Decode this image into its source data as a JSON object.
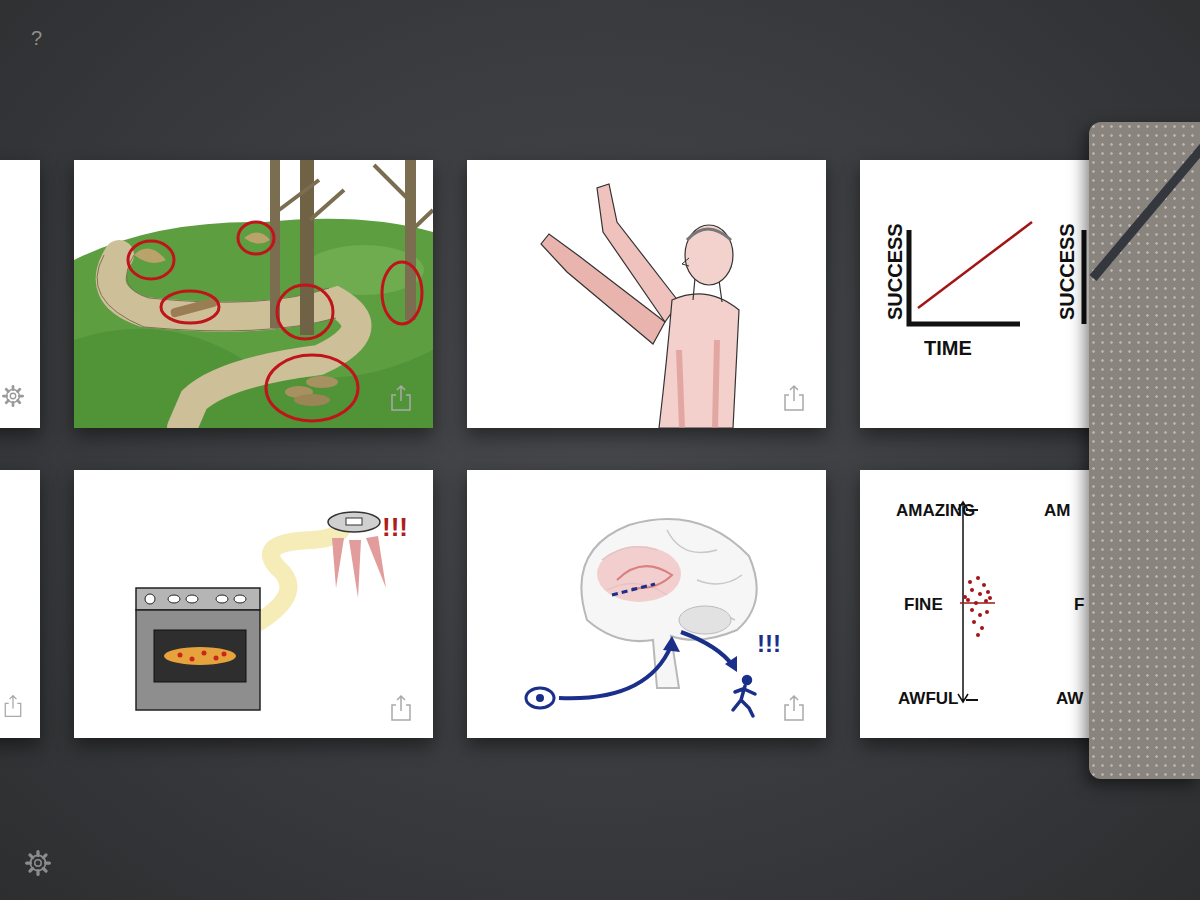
{
  "help_button": "?",
  "rows": [
    {
      "pages": [
        {
          "kind": "settings-stub"
        },
        {
          "kind": "forest"
        },
        {
          "kind": "figure"
        },
        {
          "kind": "success-chart",
          "y_label": "SUCCESS",
          "x_label": "TIME",
          "second_y_label": "SUCCESS"
        }
      ]
    },
    {
      "pages": [
        {
          "kind": "share-stub"
        },
        {
          "kind": "oven",
          "alert": "!!!"
        },
        {
          "kind": "brain",
          "alert": "!!!"
        },
        {
          "kind": "mood-scale",
          "top": "AMAZING",
          "middle": "FINE",
          "bottom": "AWFUL",
          "second_top": "AM",
          "second_middle": "F",
          "second_bottom": "AW"
        }
      ]
    }
  ]
}
